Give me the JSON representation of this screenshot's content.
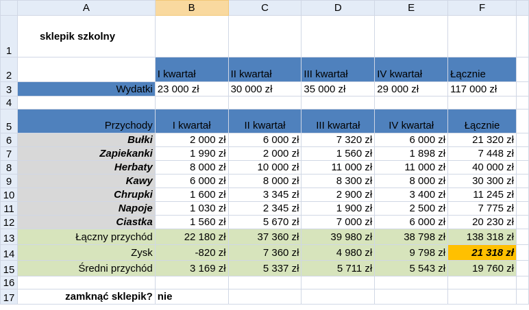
{
  "columns": [
    "A",
    "B",
    "C",
    "D",
    "E",
    "F"
  ],
  "rows": [
    "1",
    "2",
    "3",
    "4",
    "5",
    "6",
    "7",
    "8",
    "9",
    "10",
    "11",
    "12",
    "13",
    "14",
    "15",
    "16",
    "17"
  ],
  "selected_column": "B",
  "title": "sklepik szkolny",
  "quarters": [
    "I kwartał",
    "II kwartał",
    "III kwartał",
    "IV kwartał",
    "Łącznie"
  ],
  "expenses": {
    "label": "Wydatki",
    "values": [
      "23 000 zł",
      "30 000 zł",
      "35 000 zł",
      "29 000 zł",
      "117 000 zł"
    ]
  },
  "income_header": "Przychody",
  "products": [
    {
      "name": "Bułki",
      "values": [
        "2 000 zł",
        "6 000 zł",
        "7 320 zł",
        "6 000 zł",
        "21 320 zł"
      ]
    },
    {
      "name": "Zapiekanki",
      "values": [
        "1 990 zł",
        "2 000 zł",
        "1 560 zł",
        "1 898 zł",
        "7 448 zł"
      ]
    },
    {
      "name": "Herbaty",
      "values": [
        "8 000 zł",
        "10 000 zł",
        "11 000 zł",
        "11 000 zł",
        "40 000 zł"
      ]
    },
    {
      "name": "Kawy",
      "values": [
        "6 000 zł",
        "8 000 zł",
        "8 300 zł",
        "8 000 zł",
        "30 300 zł"
      ]
    },
    {
      "name": "Chrupki",
      "values": [
        "1 600 zł",
        "3 345 zł",
        "2 900 zł",
        "3 400 zł",
        "11 245 zł"
      ]
    },
    {
      "name": "Napoje",
      "values": [
        "1 030 zł",
        "2 345 zł",
        "1 900 zł",
        "2 500 zł",
        "7 775 zł"
      ]
    },
    {
      "name": "Ciastka",
      "values": [
        "1 560 zł",
        "5 670 zł",
        "7 000 zł",
        "6 000 zł",
        "20 230 zł"
      ]
    }
  ],
  "total_income": {
    "label": "Łączny przychód",
    "values": [
      "22 180 zł",
      "37 360 zł",
      "39 980 zł",
      "38 798 zł",
      "138 318 zł"
    ]
  },
  "profit": {
    "label": "Zysk",
    "values": [
      "-820 zł",
      "7 360 zł",
      "4 980 zł",
      "9 798 zł",
      "21 318 zł"
    ]
  },
  "avg_income": {
    "label": "Średni przychód",
    "values": [
      "3 169 zł",
      "5 337 zł",
      "5 711 zł",
      "5 543 zł",
      "19 760 zł"
    ]
  },
  "question": {
    "label": "zamknąć sklepik?",
    "answer": "nie"
  },
  "colors": {
    "header_blue": "#4f81bd",
    "product_gray": "#d8d8d8",
    "summary_green": "#d7e4bc",
    "highlight_orange": "#ffc000",
    "title_blue": "#1f1fcc"
  }
}
